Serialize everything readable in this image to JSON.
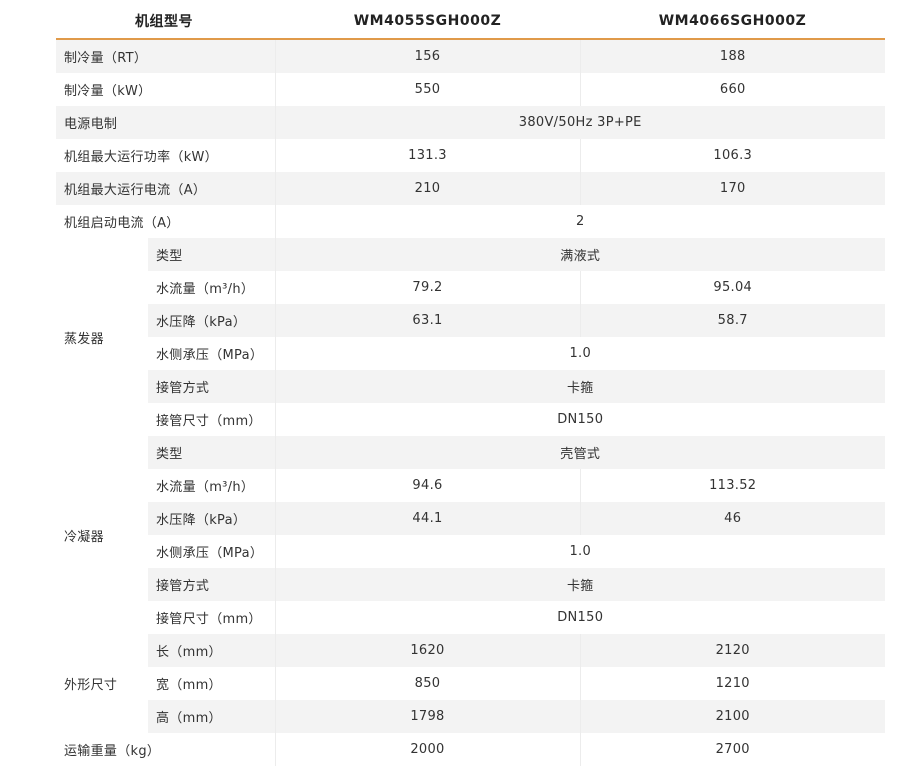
{
  "header": {
    "model_label": "机组型号",
    "model_a": "WM4055SGH000Z",
    "model_b": "WM4066SGH000Z"
  },
  "rows": {
    "cooling_rt": {
      "label": "制冷量（RT）",
      "a": "156",
      "b": "188"
    },
    "cooling_kw": {
      "label": "制冷量（kW）",
      "a": "550",
      "b": "660"
    },
    "power": {
      "label": "电源电制",
      "value": "380V/50Hz 3P+PE"
    },
    "max_power": {
      "label": "机组最大运行功率（kW）",
      "a": "131.3",
      "b": "106.3"
    },
    "max_current": {
      "label": "机组最大运行电流（A）",
      "a": "210",
      "b": "170"
    },
    "start_current": {
      "label": "机组启动电流（A）",
      "value": "2"
    }
  },
  "evaporator": {
    "group_label": "蒸发器",
    "type": {
      "label": "类型",
      "value": "满液式"
    },
    "flow": {
      "label": "水流量（m³/h）",
      "a": "79.2",
      "b": "95.04"
    },
    "pressure_drop": {
      "label": "水压降（kPa）",
      "a": "63.1",
      "b": "58.7"
    },
    "bearing": {
      "label": "水侧承压（MPa）",
      "value": "1.0"
    },
    "connection": {
      "label": "接管方式",
      "value": "卡箍"
    },
    "pipe_size": {
      "label": "接管尺寸（mm）",
      "value": "DN150"
    }
  },
  "condenser": {
    "group_label": "冷凝器",
    "type": {
      "label": "类型",
      "value": "壳管式"
    },
    "flow": {
      "label": "水流量（m³/h）",
      "a": "94.6",
      "b": "113.52"
    },
    "pressure_drop": {
      "label": "水压降（kPa）",
      "a": "44.1",
      "b": "46"
    },
    "bearing": {
      "label": "水侧承压（MPa）",
      "value": "1.0"
    },
    "connection": {
      "label": "接管方式",
      "value": "卡箍"
    },
    "pipe_size": {
      "label": "接管尺寸（mm）",
      "value": "DN150"
    }
  },
  "dimensions": {
    "group_label": "外形尺寸",
    "length": {
      "label": "长（mm）",
      "a": "1620",
      "b": "2120"
    },
    "width": {
      "label": "宽（mm）",
      "a": "850",
      "b": "1210"
    },
    "height": {
      "label": "高（mm）",
      "a": "1798",
      "b": "2100"
    }
  },
  "weight": {
    "label": "运输重量（kg）",
    "a": "2000",
    "b": "2700"
  },
  "colors": {
    "header_rule": "#e09a4a",
    "stripe": "#f3f3f3"
  }
}
